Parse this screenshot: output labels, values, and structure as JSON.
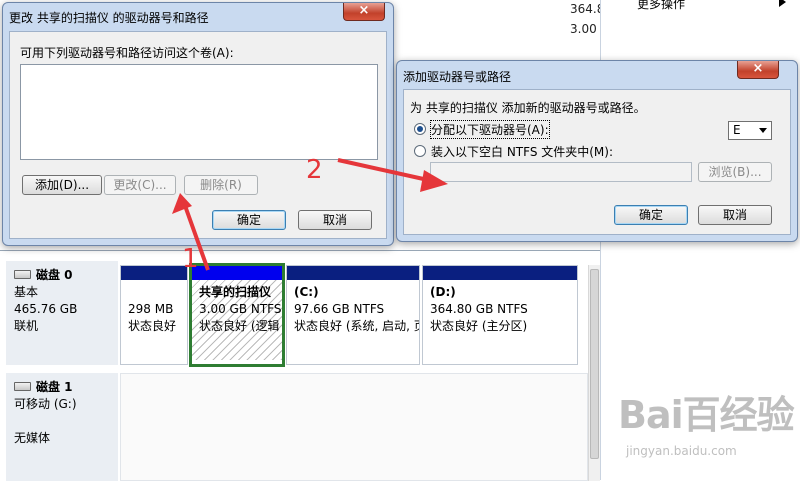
{
  "background": {
    "top_values": [
      "364.8",
      "3.00"
    ],
    "right_pane": {
      "more_actions": "更多操作"
    }
  },
  "disks": [
    {
      "name": "磁盘 0",
      "type": "基本",
      "size": "465.76 GB",
      "status": "联机"
    },
    {
      "name": "磁盘 1",
      "type": "可移动 (G:)",
      "size": "",
      "status": "无媒体"
    }
  ],
  "partitions": [
    {
      "title": "",
      "size": "298 MB",
      "status": "状态良好"
    },
    {
      "title": "共享的扫描仪",
      "size": "3.00 GB NTFS",
      "status": "状态良好 (逻辑"
    },
    {
      "title": "(C:)",
      "size": "97.66 GB NTFS",
      "status": "状态良好 (系统, 启动, 页"
    },
    {
      "title": "(D:)",
      "size": "364.80 GB NTFS",
      "status": "状态良好 (主分区)"
    }
  ],
  "dialog_change": {
    "title": "更改 共享的扫描仪 的驱动器号和路径",
    "list_label": "可用下列驱动器号和路径访问这个卷(A):",
    "add_button": "添加(D)...",
    "change_button": "更改(C)...",
    "remove_button": "删除(R)",
    "ok_button": "确定",
    "cancel_button": "取消",
    "close": "×"
  },
  "dialog_add": {
    "title": "添加驱动器号或路径",
    "description": "为 共享的扫描仪 添加新的驱动器号或路径。",
    "option_assign": "分配以下驱动器号(A):",
    "option_mount": "装入以下空白 NTFS 文件夹中(M):",
    "drive_letter": "E",
    "path_value": "",
    "browse_button": "浏览(B)...",
    "ok_button": "确定",
    "cancel_button": "取消",
    "close": "×",
    "assign_selected": true
  },
  "annotations": {
    "step1": "1",
    "step2": "2"
  },
  "colors": {
    "annotation": "#e5363a",
    "selected_partition": "#2e7d32",
    "primary_bar": "#0a1f80"
  },
  "watermark": {
    "logo": "Bai百经验",
    "url": "jingyan.baidu.com"
  }
}
